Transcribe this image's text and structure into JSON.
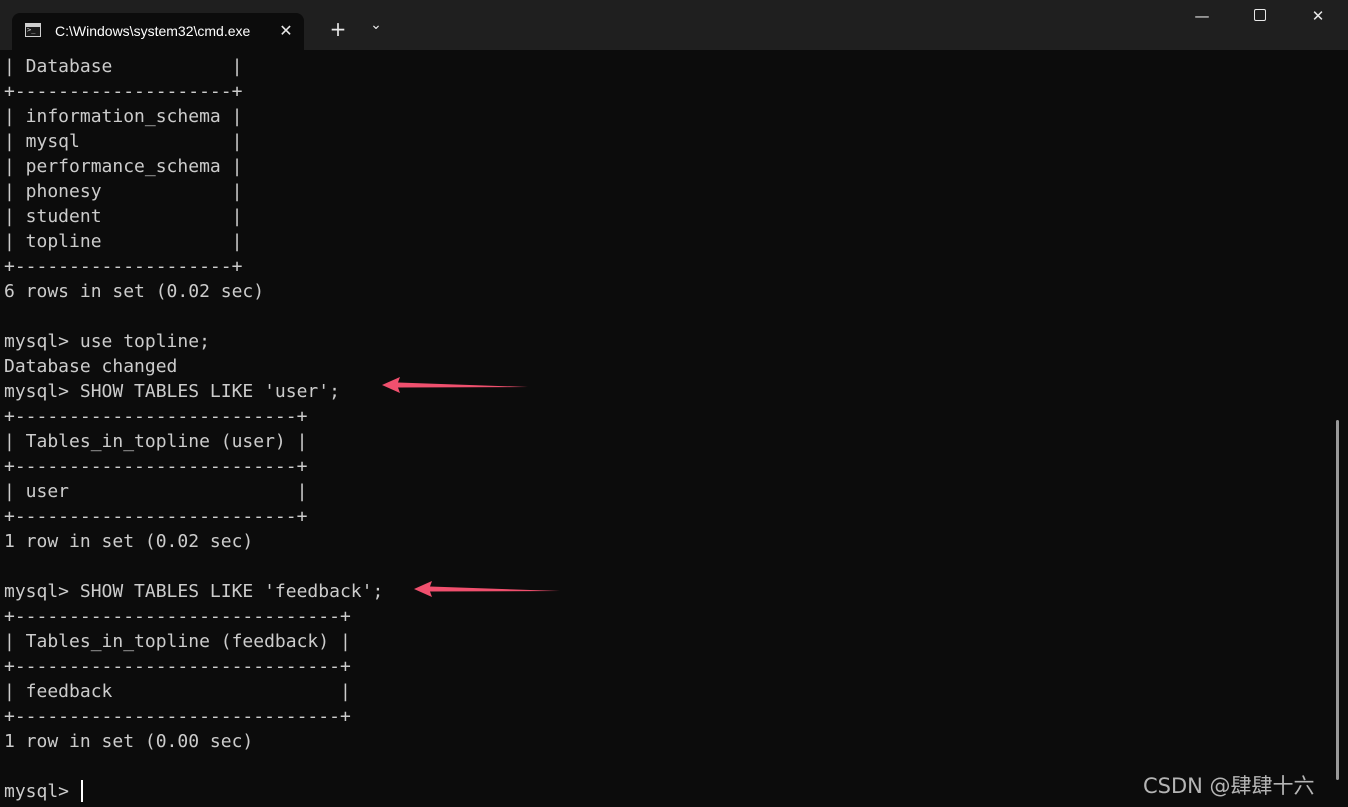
{
  "window": {
    "tab_title": "C:\\Windows\\system32\\cmd.exe",
    "tab_close_glyph": "✕",
    "new_tab_glyph": "+",
    "dropdown_glyph": "⌄",
    "minimize_glyph": "—",
    "close_glyph": "✕"
  },
  "terminal": {
    "lines": [
      "| Database           |",
      "+--------------------+",
      "| information_schema |",
      "| mysql              |",
      "| performance_schema |",
      "| phonesy            |",
      "| student            |",
      "| topline            |",
      "+--------------------+",
      "6 rows in set (0.02 sec)",
      "",
      "mysql> use topline;",
      "Database changed",
      "mysql> SHOW TABLES LIKE 'user';",
      "+--------------------------+",
      "| Tables_in_topline (user) |",
      "+--------------------------+",
      "| user                     |",
      "+--------------------------+",
      "1 row in set (0.02 sec)",
      "",
      "mysql> SHOW TABLES LIKE 'feedback';",
      "+------------------------------+",
      "| Tables_in_topline (feedback) |",
      "+------------------------------+",
      "| feedback                     |",
      "+------------------------------+",
      "1 row in set (0.00 sec)",
      ""
    ],
    "prompt": "mysql> "
  },
  "annotations": {
    "arrow_color": "#f0506e"
  },
  "watermark": "CSDN @肆肆十六"
}
